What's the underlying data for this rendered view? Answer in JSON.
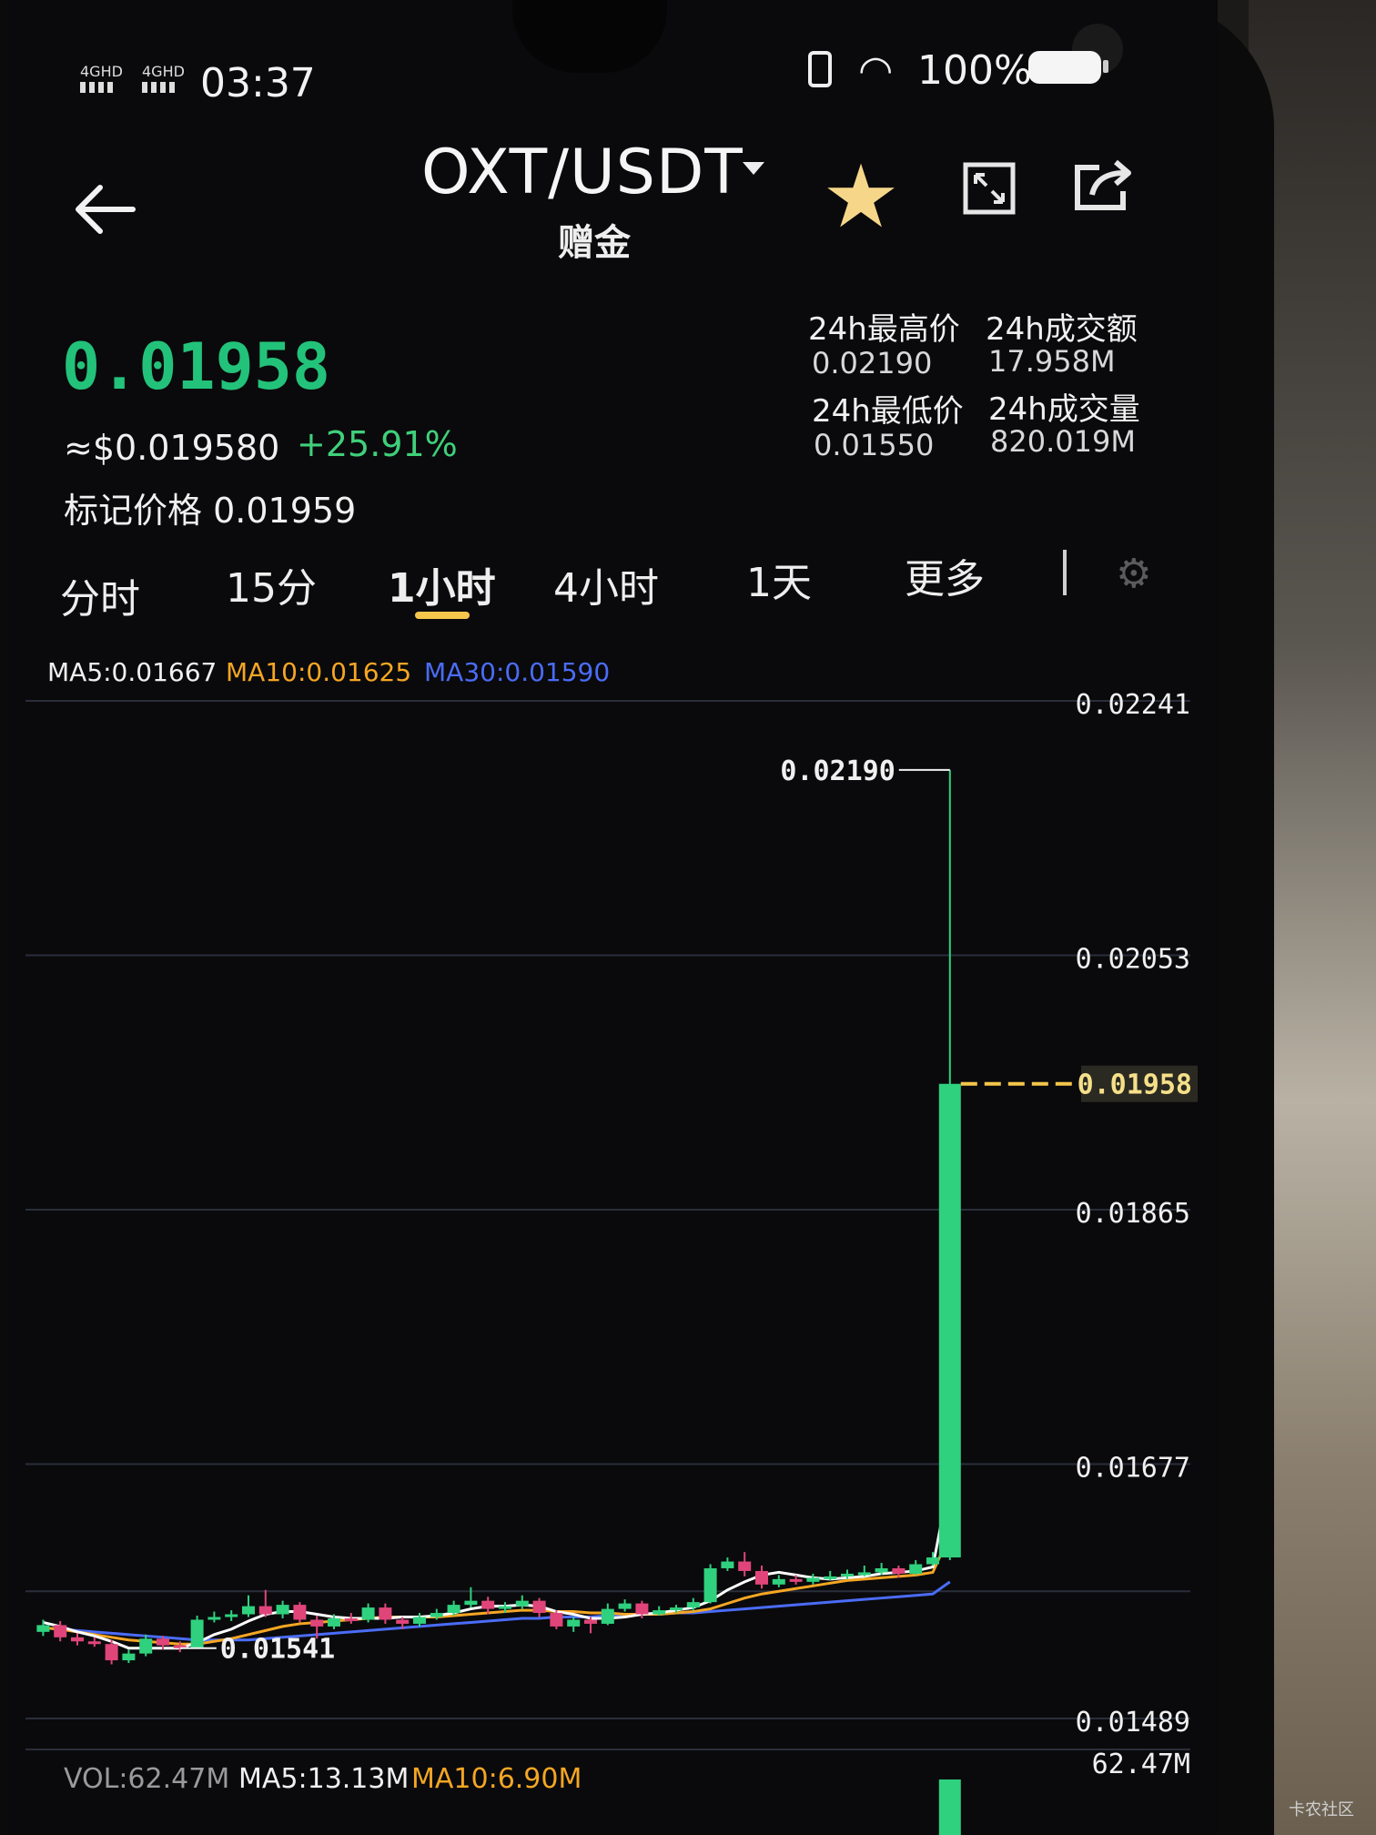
{
  "status_bar": {
    "time": "03:37",
    "battery": "100%",
    "signal_1": "4GHD",
    "signal_2": "4GHD"
  },
  "header": {
    "pair": "OXT/USDT",
    "subtitle": "赠金"
  },
  "ticker": {
    "last_price": "0.01958",
    "approx_usd": "≈$0.019580",
    "change": "+25.91%",
    "mark_label": "标记价格",
    "mark_price": "0.01959"
  },
  "stats": {
    "high_label": "24h最高价",
    "high_value": "0.02190",
    "turnover_label": "24h成交额",
    "turnover_value": "17.958M",
    "low_label": "24h最低价",
    "low_value": "0.01550",
    "volume_label": "24h成交量",
    "volume_value": "820.019M"
  },
  "tabs": [
    "分时",
    "15分",
    "1小时",
    "4小时",
    "1天",
    "更多"
  ],
  "active_tab": "1小时",
  "indicators": {
    "ma5": "MA5:0.01667",
    "ma10": "MA10:0.01625",
    "ma30": "MA30:0.01590"
  },
  "volume_indicators": {
    "vol": "VOL:62.47M",
    "ma5": "MA5:13.13M",
    "ma10": "MA10:6.90M"
  },
  "colors": {
    "up": "#2fd17e",
    "down": "#e0457a",
    "accent": "#f4c64b",
    "ma5": "#ffffff",
    "ma10": "#f5a623",
    "ma30": "#4a6cf7"
  },
  "chart_data": {
    "type": "candlestick",
    "y_ticks": [
      "0.02241",
      "0.02053",
      "0.01865",
      "0.01677",
      "0.01489"
    ],
    "ylim": [
      0.01489,
      0.02241
    ],
    "high_marker": "0.02190",
    "low_marker": "0.01541",
    "current_price": "0.01958",
    "volume_max_label": "62.47M",
    "candles": [
      {
        "o": 0.01553,
        "c": 0.01558,
        "h": 0.01562,
        "l": 0.0155
      },
      {
        "o": 0.01558,
        "c": 0.01549,
        "h": 0.01561,
        "l": 0.01546
      },
      {
        "o": 0.01549,
        "c": 0.01546,
        "h": 0.01552,
        "l": 0.01543
      },
      {
        "o": 0.01546,
        "c": 0.01544,
        "h": 0.01549,
        "l": 0.01542
      },
      {
        "o": 0.01544,
        "c": 0.01532,
        "h": 0.01547,
        "l": 0.01529
      },
      {
        "o": 0.01532,
        "c": 0.01537,
        "h": 0.0154,
        "l": 0.0153
      },
      {
        "o": 0.01537,
        "c": 0.01548,
        "h": 0.01551,
        "l": 0.01535
      },
      {
        "o": 0.01548,
        "c": 0.01543,
        "h": 0.0155,
        "l": 0.0154
      },
      {
        "o": 0.01543,
        "c": 0.01541,
        "h": 0.01546,
        "l": 0.01538
      },
      {
        "o": 0.01541,
        "c": 0.01562,
        "h": 0.01565,
        "l": 0.01541
      },
      {
        "o": 0.01562,
        "c": 0.01564,
        "h": 0.01568,
        "l": 0.0156
      },
      {
        "o": 0.01564,
        "c": 0.01566,
        "h": 0.01569,
        "l": 0.01561
      },
      {
        "o": 0.01566,
        "c": 0.01572,
        "h": 0.0158,
        "l": 0.01564
      },
      {
        "o": 0.01572,
        "c": 0.01566,
        "h": 0.01584,
        "l": 0.01564
      },
      {
        "o": 0.01566,
        "c": 0.01573,
        "h": 0.01576,
        "l": 0.01563
      },
      {
        "o": 0.01573,
        "c": 0.01562,
        "h": 0.01575,
        "l": 0.0156
      },
      {
        "o": 0.01562,
        "c": 0.01557,
        "h": 0.01565,
        "l": 0.01548
      },
      {
        "o": 0.01557,
        "c": 0.01563,
        "h": 0.01566,
        "l": 0.01555
      },
      {
        "o": 0.01563,
        "c": 0.01562,
        "h": 0.01567,
        "l": 0.01559
      },
      {
        "o": 0.01562,
        "c": 0.01571,
        "h": 0.01574,
        "l": 0.0156
      },
      {
        "o": 0.01571,
        "c": 0.01562,
        "h": 0.01574,
        "l": 0.01559
      },
      {
        "o": 0.01562,
        "c": 0.01559,
        "h": 0.01564,
        "l": 0.01555
      },
      {
        "o": 0.01559,
        "c": 0.01564,
        "h": 0.01567,
        "l": 0.01557
      },
      {
        "o": 0.01564,
        "c": 0.01567,
        "h": 0.0157,
        "l": 0.01562
      },
      {
        "o": 0.01567,
        "c": 0.01573,
        "h": 0.01576,
        "l": 0.01565
      },
      {
        "o": 0.01573,
        "c": 0.01576,
        "h": 0.01586,
        "l": 0.01571
      },
      {
        "o": 0.01576,
        "c": 0.0157,
        "h": 0.01579,
        "l": 0.01566
      },
      {
        "o": 0.0157,
        "c": 0.01572,
        "h": 0.01575,
        "l": 0.01567
      },
      {
        "o": 0.01572,
        "c": 0.01576,
        "h": 0.0158,
        "l": 0.0157
      },
      {
        "o": 0.01576,
        "c": 0.01567,
        "h": 0.01578,
        "l": 0.01564
      },
      {
        "o": 0.01567,
        "c": 0.01557,
        "h": 0.01569,
        "l": 0.01555
      },
      {
        "o": 0.01557,
        "c": 0.01562,
        "h": 0.01564,
        "l": 0.01553
      },
      {
        "o": 0.01562,
        "c": 0.01559,
        "h": 0.01564,
        "l": 0.01552
      },
      {
        "o": 0.01559,
        "c": 0.0157,
        "h": 0.01574,
        "l": 0.01558
      },
      {
        "o": 0.0157,
        "c": 0.01574,
        "h": 0.01577,
        "l": 0.01568
      },
      {
        "o": 0.01574,
        "c": 0.01566,
        "h": 0.01576,
        "l": 0.01563
      },
      {
        "o": 0.01566,
        "c": 0.01569,
        "h": 0.01572,
        "l": 0.01565
      },
      {
        "o": 0.01569,
        "c": 0.01571,
        "h": 0.01573,
        "l": 0.01567
      },
      {
        "o": 0.01571,
        "c": 0.01575,
        "h": 0.01578,
        "l": 0.01569
      },
      {
        "o": 0.01575,
        "c": 0.016,
        "h": 0.01603,
        "l": 0.01574
      },
      {
        "o": 0.016,
        "c": 0.01605,
        "h": 0.01608,
        "l": 0.01598
      },
      {
        "o": 0.01605,
        "c": 0.01598,
        "h": 0.01612,
        "l": 0.01594
      },
      {
        "o": 0.01598,
        "c": 0.01588,
        "h": 0.01602,
        "l": 0.01585
      },
      {
        "o": 0.01588,
        "c": 0.01592,
        "h": 0.01595,
        "l": 0.01586
      },
      {
        "o": 0.01592,
        "c": 0.0159,
        "h": 0.01595,
        "l": 0.01588
      },
      {
        "o": 0.0159,
        "c": 0.01593,
        "h": 0.01596,
        "l": 0.01588
      },
      {
        "o": 0.01593,
        "c": 0.01594,
        "h": 0.01598,
        "l": 0.01591
      },
      {
        "o": 0.01594,
        "c": 0.01596,
        "h": 0.01599,
        "l": 0.01592
      },
      {
        "o": 0.01596,
        "c": 0.01597,
        "h": 0.01602,
        "l": 0.01594
      },
      {
        "o": 0.01597,
        "c": 0.016,
        "h": 0.01604,
        "l": 0.01595
      },
      {
        "o": 0.016,
        "c": 0.01596,
        "h": 0.01602,
        "l": 0.01593
      },
      {
        "o": 0.01596,
        "c": 0.01603,
        "h": 0.01606,
        "l": 0.01595
      },
      {
        "o": 0.01603,
        "c": 0.01608,
        "h": 0.01612,
        "l": 0.01602
      },
      {
        "o": 0.01608,
        "c": 0.01958,
        "h": 0.0219,
        "l": 0.01606
      }
    ],
    "ma5": [
      0.0156,
      0.01557,
      0.01553,
      0.0155,
      0.01546,
      0.01541,
      0.01541,
      0.01541,
      0.01541,
      0.01545,
      0.01551,
      0.01555,
      0.01561,
      0.01566,
      0.01568,
      0.01568,
      0.01566,
      0.01564,
      0.01563,
      0.01563,
      0.01563,
      0.01564,
      0.01564,
      0.01565,
      0.01567,
      0.0157,
      0.01572,
      0.01572,
      0.01573,
      0.01572,
      0.01568,
      0.01566,
      0.01563,
      0.01563,
      0.01564,
      0.01566,
      0.01567,
      0.01569,
      0.01571,
      0.01576,
      0.01584,
      0.0159,
      0.01595,
      0.01597,
      0.01595,
      0.01593,
      0.01592,
      0.01593,
      0.01594,
      0.01596,
      0.01597,
      0.01598,
      0.01601,
      0.01667
    ],
    "ma10": [
      0.01556,
      0.01555,
      0.01553,
      0.01551,
      0.01549,
      0.01547,
      0.01546,
      0.01545,
      0.01544,
      0.01544,
      0.01546,
      0.01548,
      0.01551,
      0.01554,
      0.01557,
      0.01559,
      0.0156,
      0.01561,
      0.01562,
      0.01563,
      0.01564,
      0.01564,
      0.01564,
      0.01564,
      0.01565,
      0.01566,
      0.01567,
      0.01568,
      0.01569,
      0.01569,
      0.01568,
      0.01568,
      0.01567,
      0.01567,
      0.01566,
      0.01566,
      0.01566,
      0.01567,
      0.01568,
      0.0157,
      0.01574,
      0.01578,
      0.01581,
      0.01583,
      0.01585,
      0.01587,
      0.01589,
      0.01591,
      0.01592,
      0.01593,
      0.01594,
      0.01595,
      0.01597,
      0.01625
    ],
    "ma30": [
      0.01556,
      0.01555,
      0.01554,
      0.01553,
      0.01552,
      0.01551,
      0.0155,
      0.01549,
      0.01548,
      0.01547,
      0.01547,
      0.01547,
      0.01547,
      0.01548,
      0.01549,
      0.0155,
      0.01551,
      0.01552,
      0.01553,
      0.01554,
      0.01555,
      0.01556,
      0.01557,
      0.01558,
      0.01559,
      0.0156,
      0.01561,
      0.01562,
      0.01563,
      0.01563,
      0.01564,
      0.01564,
      0.01564,
      0.01565,
      0.01565,
      0.01566,
      0.01566,
      0.01567,
      0.01567,
      0.01568,
      0.01569,
      0.0157,
      0.01571,
      0.01572,
      0.01573,
      0.01574,
      0.01575,
      0.01576,
      0.01577,
      0.01578,
      0.01579,
      0.0158,
      0.01581,
      0.0159
    ],
    "volume_last": 62.47
  },
  "watermark": "卡农社区"
}
